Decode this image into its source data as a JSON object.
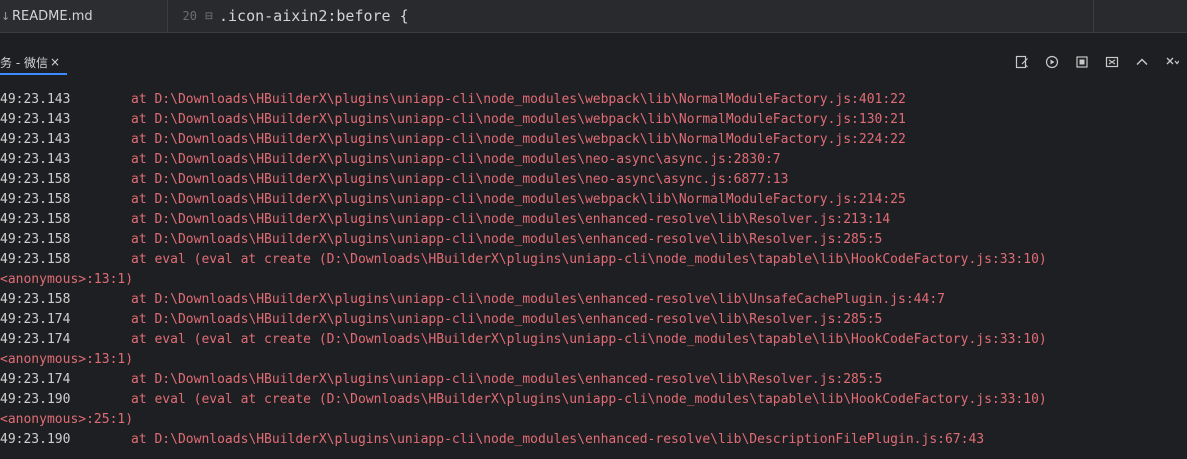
{
  "file_tree": {
    "item_icon": "↓",
    "item_label": "README.md"
  },
  "editor": {
    "line_number": "20",
    "fold_icon": "⊟",
    "code": ".icon-aixin2:before {"
  },
  "console": {
    "tab_label": "务 - 微信",
    "tab_close": "×",
    "toolbar": [
      {
        "name": "clear-log-icon"
      },
      {
        "name": "scroll-lock-icon"
      },
      {
        "name": "stop-icon"
      },
      {
        "name": "restore-panel-icon"
      },
      {
        "name": "chevron-up-icon"
      },
      {
        "name": "close-panel-icon"
      }
    ],
    "lines": [
      {
        "ts": "49:23.143",
        "msg": "at D:\\Downloads\\HBuilderX\\plugins\\uniapp-cli\\node_modules\\webpack\\lib\\NormalModuleFactory.js:401:22"
      },
      {
        "ts": "49:23.143",
        "msg": "at D:\\Downloads\\HBuilderX\\plugins\\uniapp-cli\\node_modules\\webpack\\lib\\NormalModuleFactory.js:130:21"
      },
      {
        "ts": "49:23.143",
        "msg": "at D:\\Downloads\\HBuilderX\\plugins\\uniapp-cli\\node_modules\\webpack\\lib\\NormalModuleFactory.js:224:22"
      },
      {
        "ts": "49:23.143",
        "msg": "at D:\\Downloads\\HBuilderX\\plugins\\uniapp-cli\\node_modules\\neo-async\\async.js:2830:7"
      },
      {
        "ts": "49:23.158",
        "msg": "at D:\\Downloads\\HBuilderX\\plugins\\uniapp-cli\\node_modules\\neo-async\\async.js:6877:13"
      },
      {
        "ts": "49:23.158",
        "msg": "at D:\\Downloads\\HBuilderX\\plugins\\uniapp-cli\\node_modules\\webpack\\lib\\NormalModuleFactory.js:214:25"
      },
      {
        "ts": "49:23.158",
        "msg": "at D:\\Downloads\\HBuilderX\\plugins\\uniapp-cli\\node_modules\\enhanced-resolve\\lib\\Resolver.js:213:14"
      },
      {
        "ts": "49:23.158",
        "msg": "at D:\\Downloads\\HBuilderX\\plugins\\uniapp-cli\\node_modules\\enhanced-resolve\\lib\\Resolver.js:285:5"
      },
      {
        "ts": "49:23.158",
        "msg": "at eval (eval at create (D:\\Downloads\\HBuilderX\\plugins\\uniapp-cli\\node_modules\\tapable\\lib\\HookCodeFactory.js:33:10)"
      },
      {
        "ts": "",
        "msg": "<anonymous>:13:1)"
      },
      {
        "ts": "49:23.158",
        "msg": "at D:\\Downloads\\HBuilderX\\plugins\\uniapp-cli\\node_modules\\enhanced-resolve\\lib\\UnsafeCachePlugin.js:44:7"
      },
      {
        "ts": "49:23.174",
        "msg": "at D:\\Downloads\\HBuilderX\\plugins\\uniapp-cli\\node_modules\\enhanced-resolve\\lib\\Resolver.js:285:5"
      },
      {
        "ts": "49:23.174",
        "msg": "at eval (eval at create (D:\\Downloads\\HBuilderX\\plugins\\uniapp-cli\\node_modules\\tapable\\lib\\HookCodeFactory.js:33:10)"
      },
      {
        "ts": "",
        "msg": "<anonymous>:13:1)"
      },
      {
        "ts": "49:23.174",
        "msg": "at D:\\Downloads\\HBuilderX\\plugins\\uniapp-cli\\node_modules\\enhanced-resolve\\lib\\Resolver.js:285:5"
      },
      {
        "ts": "49:23.190",
        "msg": "at eval (eval at create (D:\\Downloads\\HBuilderX\\plugins\\uniapp-cli\\node_modules\\tapable\\lib\\HookCodeFactory.js:33:10)"
      },
      {
        "ts": "",
        "msg": "<anonymous>:25:1)"
      },
      {
        "ts": "49:23.190",
        "msg": "at D:\\Downloads\\HBuilderX\\plugins\\uniapp-cli\\node_modules\\enhanced-resolve\\lib\\DescriptionFilePlugin.js:67:43"
      }
    ]
  },
  "colors": {
    "error_text": "#e06c75",
    "timestamp_text": "#cfcfcf",
    "tab_accent": "#3d8bfd"
  }
}
